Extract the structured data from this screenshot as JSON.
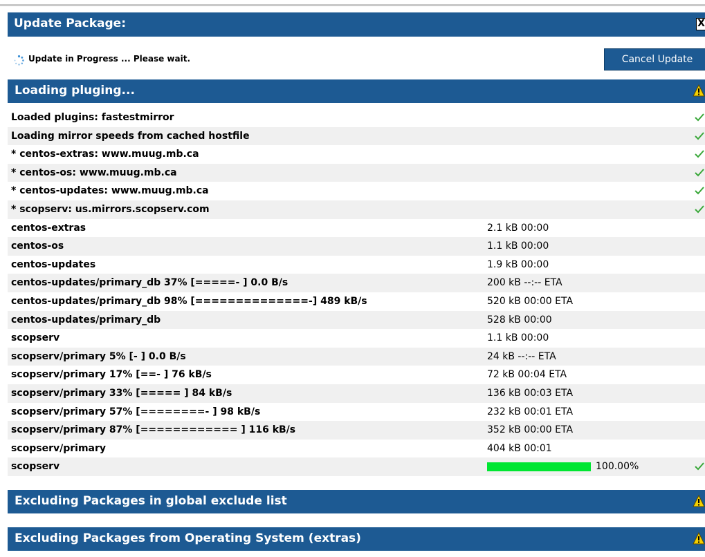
{
  "dialog": {
    "title": "Update Package:",
    "close_label": "X"
  },
  "progress": {
    "status_text": "Update in Progress ... Please wait.",
    "cancel_label": "Cancel Update"
  },
  "sections": [
    {
      "label": "Loading pluging...",
      "icon": "warning-icon"
    },
    {
      "label": "Excluding Packages in global exclude list",
      "icon": "warning-icon"
    },
    {
      "label": "Excluding Packages from Operating System (extras)",
      "icon": "warning-icon"
    }
  ],
  "log_rows": [
    {
      "msg": "Loaded plugins: fastestmirror",
      "info": "",
      "check": true
    },
    {
      "msg": "Loading mirror speeds from cached hostfile",
      "info": "",
      "check": true
    },
    {
      "msg": "* centos-extras: www.muug.mb.ca",
      "info": "",
      "check": true
    },
    {
      "msg": "* centos-os: www.muug.mb.ca",
      "info": "",
      "check": true
    },
    {
      "msg": "* centos-updates: www.muug.mb.ca",
      "info": "",
      "check": true
    },
    {
      "msg": "* scopserv: us.mirrors.scopserv.com",
      "info": "",
      "check": true
    },
    {
      "msg": "centos-extras",
      "info": "2.1 kB 00:00",
      "check": false
    },
    {
      "msg": "centos-os",
      "info": "1.1 kB 00:00",
      "check": false
    },
    {
      "msg": "centos-updates",
      "info": "1.9 kB 00:00",
      "check": false
    },
    {
      "msg": "centos-updates/primary_db 37% [=====- ] 0.0 B/s",
      "info": "200 kB --:-- ETA",
      "check": false
    },
    {
      "msg": "centos-updates/primary_db 98% [==============-] 489 kB/s",
      "info": "520 kB 00:00 ETA",
      "check": false
    },
    {
      "msg": "centos-updates/primary_db",
      "info": "528 kB 00:00",
      "check": false
    },
    {
      "msg": "scopserv",
      "info": "1.1 kB 00:00",
      "check": false
    },
    {
      "msg": "scopserv/primary 5% [- ] 0.0 B/s",
      "info": "24 kB --:-- ETA",
      "check": false
    },
    {
      "msg": "scopserv/primary 17% [==- ] 76 kB/s",
      "info": "72 kB 00:04 ETA",
      "check": false
    },
    {
      "msg": "scopserv/primary 33% [===== ] 84 kB/s",
      "info": "136 kB 00:03 ETA",
      "check": false
    },
    {
      "msg": "scopserv/primary 57% [========- ] 98 kB/s",
      "info": "232 kB 00:01 ETA",
      "check": false
    },
    {
      "msg": "scopserv/primary 87% [============ ] 116 kB/s",
      "info": "352 kB 00:00 ETA",
      "check": false
    },
    {
      "msg": "scopserv/primary",
      "info": "404 kB 00:01",
      "check": false
    },
    {
      "msg": "scopserv",
      "info": "",
      "progress_fraction": 1.0,
      "progress_label": "100.00%",
      "check": true
    }
  ],
  "colors": {
    "header_blue": "#1d5a93",
    "progress_green": "#00e632",
    "check_green": "#3aa83a",
    "warning_yellow": "#f5d000"
  }
}
